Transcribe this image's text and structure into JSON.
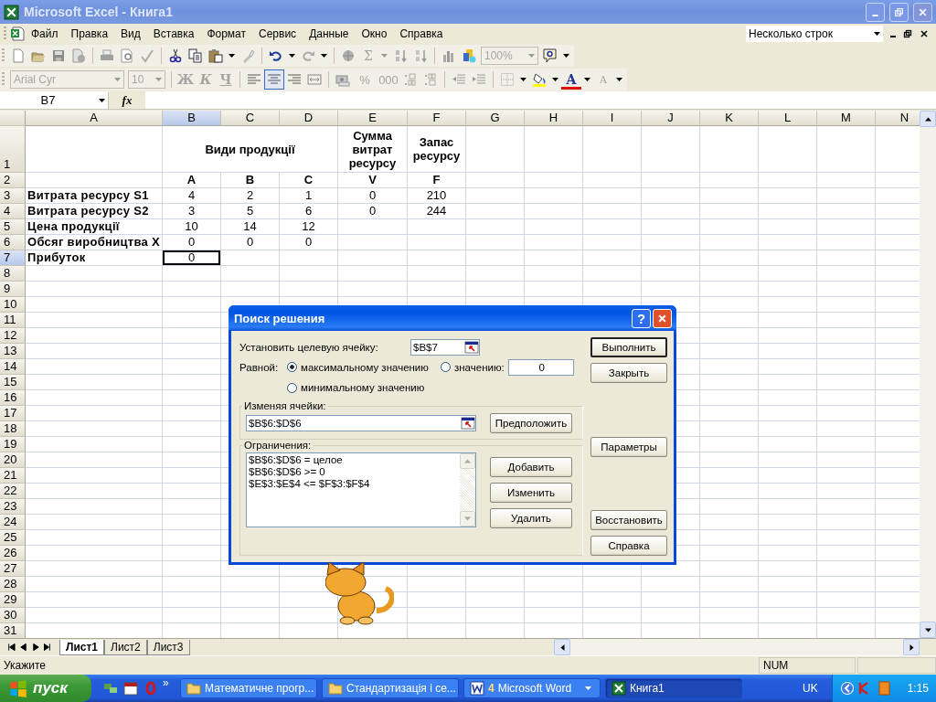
{
  "window": {
    "title": "Microsoft Excel - Книга1"
  },
  "menu": {
    "items": [
      "Файл",
      "Правка",
      "Вид",
      "Вставка",
      "Формат",
      "Сервис",
      "Данные",
      "Окно",
      "Справка"
    ],
    "question_box": "Несколько строк"
  },
  "standard_toolbar": {
    "sum": "Σ",
    "zoom": "100%"
  },
  "format_toolbar": {
    "font": "Arial Cyr",
    "size": "10",
    "style_buttons": [
      "Ж",
      "К",
      "Ч"
    ],
    "number_buttons": [
      "%",
      "000"
    ],
    "font_color": "A",
    "font_size_letter": "A"
  },
  "formula_bar": {
    "name_box": "B7",
    "function_label": "fx"
  },
  "sheet": {
    "columns": [
      {
        "label": "A",
        "selected": false
      },
      {
        "label": "B",
        "selected": true
      },
      {
        "label": "C",
        "selected": false
      },
      {
        "label": "D",
        "selected": false
      },
      {
        "label": "E",
        "selected": false
      },
      {
        "label": "F",
        "selected": false
      },
      {
        "label": "G",
        "selected": false
      },
      {
        "label": "H",
        "selected": false
      },
      {
        "label": "I",
        "selected": false
      },
      {
        "label": "J",
        "selected": false
      },
      {
        "label": "K",
        "selected": false
      },
      {
        "label": "L",
        "selected": false
      },
      {
        "label": "M",
        "selected": false
      },
      {
        "label": "N",
        "selected": false
      }
    ],
    "rows": [
      {
        "number": "1",
        "selected": false,
        "kind": "header",
        "values": [
          {
            "text": "Види продукції",
            "kind": "group",
            "selected": false
          },
          {
            "text": "Сумма витрат ресурсу",
            "kind": "cell",
            "selected": false
          },
          {
            "text": "Запас ресурсу",
            "kind": "cell",
            "selected": false
          }
        ]
      },
      {
        "number": "2",
        "selected": false,
        "kind": "header",
        "values": [
          {
            "text": "A",
            "kind": "cell",
            "selected": false
          },
          {
            "text": "B",
            "kind": "cell",
            "selected": false
          },
          {
            "text": "C",
            "kind": "cell",
            "selected": false
          },
          {
            "text": "V",
            "kind": "cell",
            "selected": false
          },
          {
            "text": "F",
            "kind": "cell",
            "selected": false
          }
        ]
      },
      {
        "number": "3",
        "selected": false,
        "kind": "data",
        "label": "Витрата ресурсу S1",
        "values": [
          {
            "text": "4",
            "kind": "cell",
            "selected": false
          },
          {
            "text": "2",
            "kind": "cell",
            "selected": false
          },
          {
            "text": "1",
            "kind": "cell",
            "selected": false
          },
          {
            "text": "0",
            "kind": "cell",
            "selected": false
          },
          {
            "text": "210",
            "kind": "cell",
            "selected": false
          }
        ]
      },
      {
        "number": "4",
        "selected": false,
        "kind": "data",
        "label": "Витрата ресурсу S2",
        "values": [
          {
            "text": "3",
            "kind": "cell",
            "selected": false
          },
          {
            "text": "5",
            "kind": "cell",
            "selected": false
          },
          {
            "text": "6",
            "kind": "cell",
            "selected": false
          },
          {
            "text": "0",
            "kind": "cell",
            "selected": false
          },
          {
            "text": "244",
            "kind": "cell",
            "selected": false
          }
        ]
      },
      {
        "number": "5",
        "selected": false,
        "kind": "data",
        "label": "Цена продукції",
        "values": [
          {
            "text": "10",
            "kind": "cell",
            "selected": false
          },
          {
            "text": "14",
            "kind": "cell",
            "selected": false
          },
          {
            "text": "12",
            "kind": "cell",
            "selected": false
          }
        ]
      },
      {
        "number": "6",
        "selected": false,
        "kind": "data",
        "label": "Обсяг виробництва X",
        "values": [
          {
            "text": "0",
            "kind": "cell",
            "selected": false
          },
          {
            "text": "0",
            "kind": "cell",
            "selected": false
          },
          {
            "text": "0",
            "kind": "cell",
            "selected": false
          }
        ]
      },
      {
        "number": "7",
        "selected": true,
        "kind": "data",
        "label": "Прибуток",
        "values": [
          {
            "text": "0",
            "kind": "cell",
            "selected": true
          }
        ]
      },
      {
        "number": "8",
        "selected": false,
        "kind": "data"
      },
      {
        "number": "9",
        "selected": false,
        "kind": "data"
      },
      {
        "number": "10",
        "selected": false,
        "kind": "data"
      },
      {
        "number": "11",
        "selected": false,
        "kind": "data"
      },
      {
        "number": "12",
        "selected": false,
        "kind": "data"
      },
      {
        "number": "13",
        "selected": false,
        "kind": "data"
      },
      {
        "number": "14",
        "selected": false,
        "kind": "data"
      },
      {
        "number": "15",
        "selected": false,
        "kind": "data"
      },
      {
        "number": "16",
        "selected": false,
        "kind": "data"
      },
      {
        "number": "17",
        "selected": false,
        "kind": "data"
      },
      {
        "number": "18",
        "selected": false,
        "kind": "data"
      },
      {
        "number": "19",
        "selected": false,
        "kind": "data"
      },
      {
        "number": "20",
        "selected": false,
        "kind": "data"
      },
      {
        "number": "21",
        "selected": false,
        "kind": "data"
      },
      {
        "number": "22",
        "selected": false,
        "kind": "data"
      },
      {
        "number": "23",
        "selected": false,
        "kind": "data"
      },
      {
        "number": "24",
        "selected": false,
        "kind": "data"
      },
      {
        "number": "25",
        "selected": false,
        "kind": "data"
      },
      {
        "number": "26",
        "selected": false,
        "kind": "data"
      },
      {
        "number": "27",
        "selected": false,
        "kind": "data"
      },
      {
        "number": "28",
        "selected": false,
        "kind": "data"
      },
      {
        "number": "29",
        "selected": false,
        "kind": "data"
      },
      {
        "number": "30",
        "selected": false,
        "kind": "data"
      },
      {
        "number": "31",
        "selected": false,
        "kind": "data"
      }
    ]
  },
  "sheet_tabs": [
    {
      "label": "Лист1",
      "selected": true
    },
    {
      "label": "Лист2",
      "selected": false
    },
    {
      "label": "Лист3",
      "selected": false
    }
  ],
  "status_bar": {
    "text": "Укажите",
    "indicator": "NUM"
  },
  "dialog": {
    "title": "Поиск решения",
    "help": "?",
    "target_label": "Установить целевую ячейку:",
    "target": "$B$7",
    "equal_label": "Равной:",
    "options": [
      {
        "label": "максимальному значению",
        "selected": true
      },
      {
        "label": "значению:",
        "selected": false
      },
      {
        "label": "минимальному значению",
        "selected": false
      }
    ],
    "value": "0",
    "changing_label": "Изменяя ячейки:",
    "changing": "$B$6:$D$6",
    "guess_button": "Предположить",
    "constraints_label": "Ограничения:",
    "constraints": [
      "$B$6:$D$6 = целое",
      "$B$6:$D$6 >= 0",
      "$E$3:$E$4 <= $F$3:$F$4"
    ],
    "constraint_buttons": [
      "Добавить",
      "Изменить",
      "Удалить"
    ],
    "button_groups": [
      {
        "buttons": [
          {
            "label": "Выполнить",
            "default": true
          },
          {
            "label": "Закрыть",
            "default": false
          }
        ]
      },
      {
        "buttons": [
          {
            "label": "Параметры",
            "default": false
          }
        ]
      },
      {
        "buttons": [
          {
            "label": "Восстановить",
            "default": false
          },
          {
            "label": "Справка",
            "default": false
          }
        ]
      }
    ]
  },
  "taskbar": {
    "start": "пуск",
    "more": "»",
    "tasks": [
      {
        "label": "Математичне прогр...",
        "kind": "folder",
        "selected": false
      },
      {
        "label": "Стандартизація і се...",
        "kind": "folder",
        "selected": false
      },
      {
        "count": "4",
        "label": "Microsoft Word",
        "kind": "word",
        "selected": false
      },
      {
        "label": "Книга1",
        "kind": "excel",
        "selected": true
      }
    ],
    "language": "UK",
    "clock": "1:15"
  }
}
